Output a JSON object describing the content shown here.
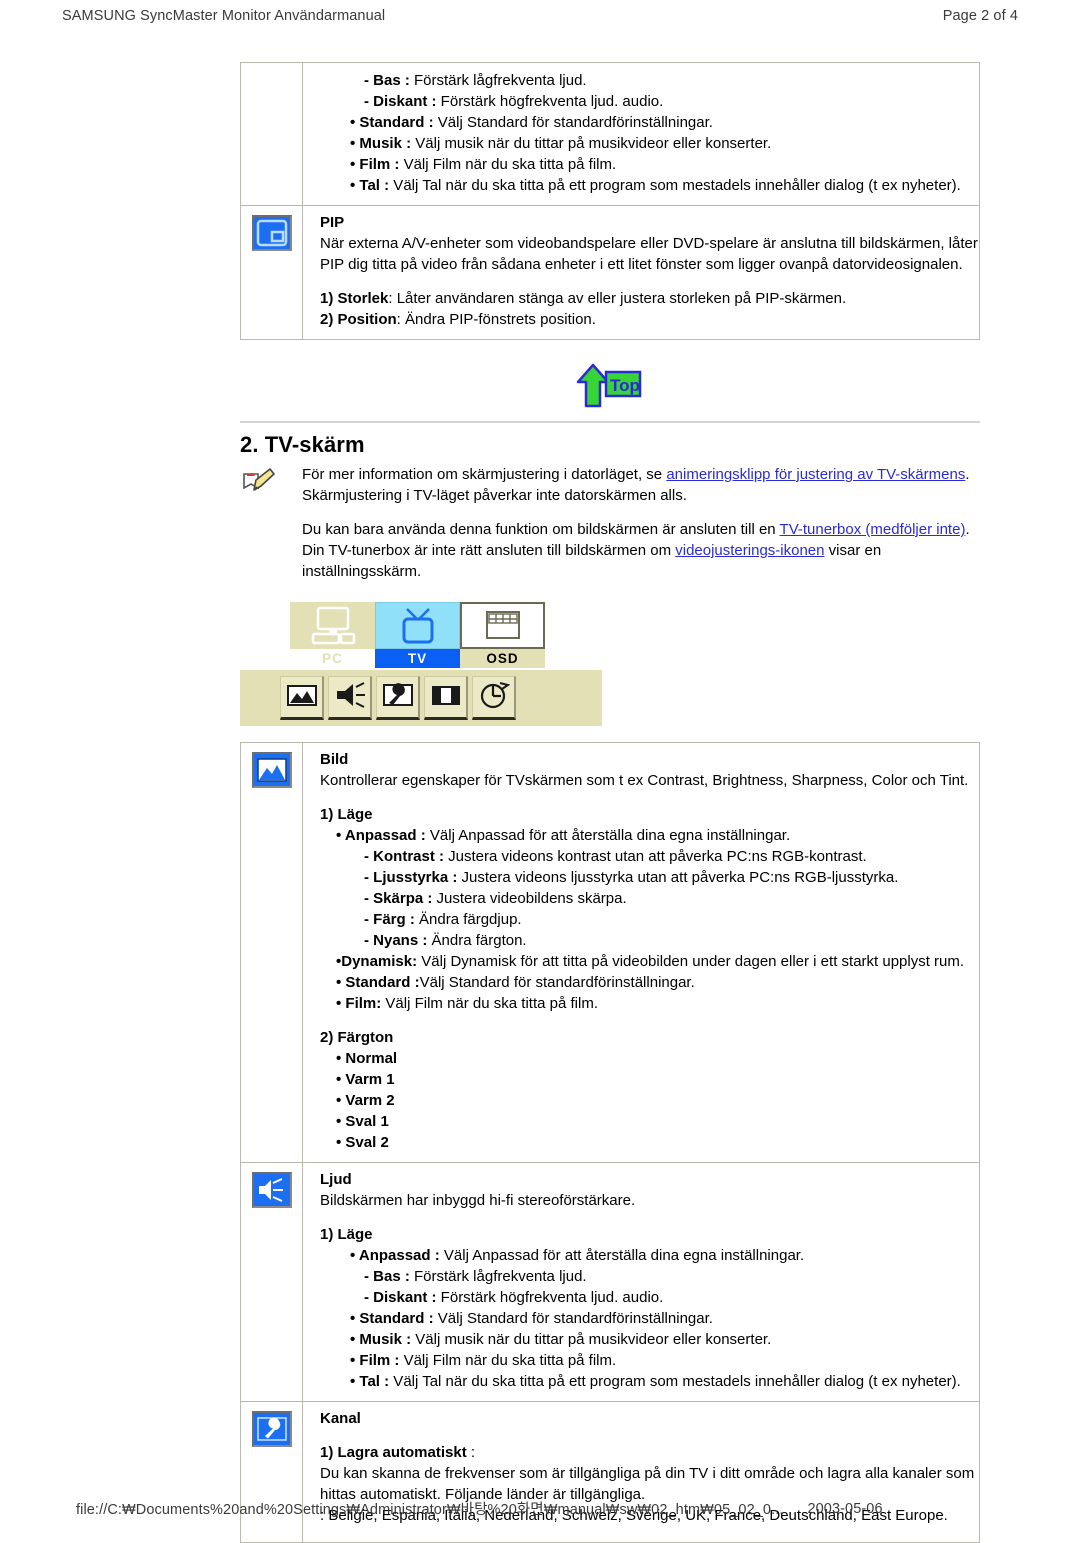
{
  "header": {
    "title": "SAMSUNG SyncMaster Monitor Användarmanual",
    "page": "Page 2 of  4"
  },
  "footer": {
    "url": "file://C:₩Documents%20and%20Settings₩Administrator₩바탕%20화면₩manual₩sw₩02_htm₩05_02_0...",
    "date": "2003-05-06"
  },
  "colors": {
    "link": "#2b2bd4",
    "table_border": "#b9b9b0",
    "icon_blue": "#1b6ff0",
    "osd_cream": "#e2e0b4",
    "osd_tv_blue": "#0a5ff5",
    "osd_tv_light": "#8fe0f8"
  },
  "continued_sound_list": {
    "lines": [
      {
        "indent": "i2",
        "bold": "- Bas :",
        "rest": " Förstärk lågfrekventa ljud."
      },
      {
        "indent": "i2",
        "bold": "- Diskant :",
        "rest": " Förstärk högfrekventa ljud. audio."
      },
      {
        "indent": "i3",
        "bold": "• Standard :",
        "rest": " Välj Standard för standardförinställningar."
      },
      {
        "indent": "i3",
        "bold": "• Musik :",
        "rest": " Välj musik när du tittar på musikvideor eller konserter."
      },
      {
        "indent": "i3",
        "bold": "• Film :",
        "rest": " Välj Film när du ska titta på film."
      },
      {
        "indent": "i3",
        "bold": "• Tal :",
        "rest": " Välj Tal när du ska titta på ett program som mestadels innehåller dialog (t ex nyheter)."
      }
    ]
  },
  "pip": {
    "icon": "pip-icon",
    "title": "PIP",
    "desc_line1": "När externa A/V-enheter som videobandspelare eller DVD-spelare är anslutna till bildskärmen, låter",
    "desc_line2": "PIP dig titta på video från sådana enheter i ett litet fönster som ligger ovanpå datorvideosignalen.",
    "items": [
      {
        "bold": "1) Storlek",
        "rest": ": Låter användaren stänga av eller justera storleken på PIP-skärmen."
      },
      {
        "bold": "2) Position",
        "rest": ": Ändra PIP-fönstrets position."
      }
    ]
  },
  "top_button": {
    "label": "Top",
    "icon": "top-arrow-icon"
  },
  "tv_section": {
    "heading": "2. TV-skärm",
    "note_icon": "pencil-note-icon",
    "para1": {
      "pre": "För mer information om skärmjustering i datorläget, se ",
      "link": "animeringsklipp för justering av TV-skärmens",
      "post": ". Skärmjustering i TV-läget påverkar inte datorskärmen alls."
    },
    "para2": {
      "pre": "Du kan bara använda denna funktion om bildskärmen är ansluten till en ",
      "link": "TV-tunerbox (medföljer inte)",
      "post": "."
    },
    "para3": {
      "pre": "Din TV-tunerbox är inte rätt ansluten till bildskärmen om ",
      "link": "videojusterings-ikonen",
      "post": " visar en inställningsskärm."
    }
  },
  "osd_image": {
    "tabs": [
      {
        "label": "PC",
        "icon": "monitor-icon",
        "state": "inactive"
      },
      {
        "label": "TV",
        "icon": "tv-icon",
        "state": "active"
      },
      {
        "label": "OSD",
        "icon": "osd-grid-icon",
        "state": "inactive"
      }
    ],
    "buttons": [
      {
        "icon": "picture-icon"
      },
      {
        "icon": "speaker-icon"
      },
      {
        "icon": "wrench-icon"
      },
      {
        "icon": "pip-split-icon"
      },
      {
        "icon": "clock-icon"
      }
    ]
  },
  "bild": {
    "icon": "picture-icon",
    "title": "Bild",
    "desc": "Kontrollerar egenskaper för TVskärmen som t ex Contrast, Brightness, Sharpness, Color och Tint.",
    "group1_title": "1) Läge",
    "group1_lines": [
      {
        "indent": "i1",
        "bold": "• Anpassad :",
        "rest": " Välj Anpassad för att återställa dina egna inställningar."
      },
      {
        "indent": "i2",
        "bold": "- Kontrast :",
        "rest": " Justera videons kontrast utan att påverka PC:ns RGB-kontrast."
      },
      {
        "indent": "i2",
        "bold": "- Ljusstyrka :",
        "rest": " Justera videons ljusstyrka utan att påverka PC:ns RGB-ljusstyrka."
      },
      {
        "indent": "i2",
        "bold": "- Skärpa :",
        "rest": " Justera videobildens skärpa."
      },
      {
        "indent": "i2",
        "bold": "- Färg :",
        "rest": " Ändra färgdjup."
      },
      {
        "indent": "i2",
        "bold": "- Nyans :",
        "rest": " Ändra färgton."
      },
      {
        "indent": "i1",
        "bold": "•Dynamisk:",
        "rest": " Välj Dynamisk för att titta på videobilden under dagen eller i ett starkt upplyst rum."
      },
      {
        "indent": "i1",
        "bold": "• Standard :",
        "rest": "Välj Standard för standardförinställningar."
      },
      {
        "indent": "i1",
        "bold": "• Film:",
        "rest": " Välj Film när du ska titta på film."
      }
    ],
    "group2_title": "2) Färgton",
    "group2_items": [
      "• Normal",
      "• Varm 1",
      "• Varm 2",
      "• Sval 1",
      "• Sval 2"
    ]
  },
  "ljud": {
    "icon": "speaker-icon",
    "title": "Ljud",
    "desc": "Bildskärmen har inbyggd hi-fi stereoförstärkare.",
    "group1_title": "1) Läge",
    "group1_lines": [
      {
        "indent": "i3",
        "bold": "• Anpassad :",
        "rest": " Välj Anpassad för att återställa dina egna inställningar."
      },
      {
        "indent": "i2",
        "bold": "- Bas :",
        "rest": " Förstärk lågfrekventa ljud."
      },
      {
        "indent": "i2",
        "bold": "- Diskant :",
        "rest": " Förstärk högfrekventa ljud. audio."
      },
      {
        "indent": "i3",
        "bold": "• Standard :",
        "rest": " Välj Standard för standardförinställningar."
      },
      {
        "indent": "i3",
        "bold": "• Musik :",
        "rest": " Välj musik när du tittar på musikvideor eller konserter."
      },
      {
        "indent": "i3",
        "bold": "• Film :",
        "rest": " Välj Film när du ska titta på film."
      },
      {
        "indent": "i3",
        "bold": "• Tal :",
        "rest": " Välj Tal när du ska titta på ett program som mestadels innehåller dialog (t ex nyheter)."
      }
    ]
  },
  "kanal": {
    "icon": "wrench-icon",
    "title": "Kanal",
    "group1_bold": "1) Lagra automatiskt",
    "group1_rest": " :",
    "desc_line1": "Du kan skanna de frekvenser som är tillgängliga på din TV i ditt område och lagra alla kanaler som",
    "desc_line2": "hittas automatiskt. Följande länder är tillgängliga.",
    "desc_line3": ": Beligie, Espania, Italia, Nederland, Schweiz, Sverige, UK, France, Deutschland, East Europe."
  }
}
